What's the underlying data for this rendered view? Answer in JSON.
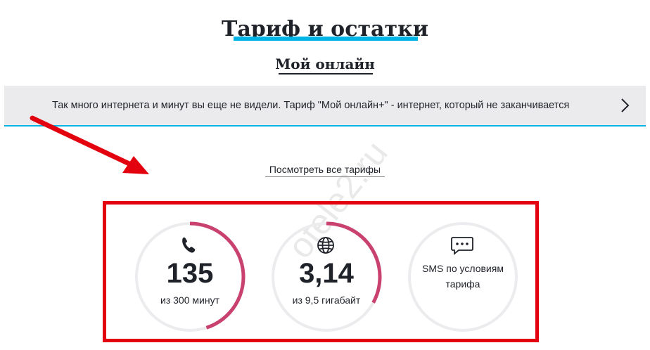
{
  "header": {
    "title": "Тариф и остатки",
    "tariff_name": "Мой онлайн"
  },
  "promo": {
    "text": "Так много интернета и минут вы еще не видели. Тариф \"Мой онлайн+\" - интернет, который не заканчивается",
    "chevron_icon": "chevron-right-icon"
  },
  "links": {
    "all_tariffs": "Посмотреть все тарифы"
  },
  "balances": [
    {
      "icon": "phone-icon",
      "value": "135",
      "label": "из 300 минут",
      "remaining_fraction": 0.45
    },
    {
      "icon": "globe-icon",
      "value": "3,14",
      "label": "из 9,5 гигабайт",
      "remaining_fraction": 0.33
    },
    {
      "icon": "chat-bubble-icon",
      "text_line1": "SMS по условиям",
      "text_line2": "тарифа",
      "remaining_fraction": 0
    }
  ],
  "watermark": "otele2.ru",
  "colors": {
    "accent_blue": "#00b4e6",
    "ring_progress": "#c8416f",
    "ring_track": "#ececef",
    "annotation_red": "#e3000f",
    "banner_bg": "#ebebee"
  }
}
